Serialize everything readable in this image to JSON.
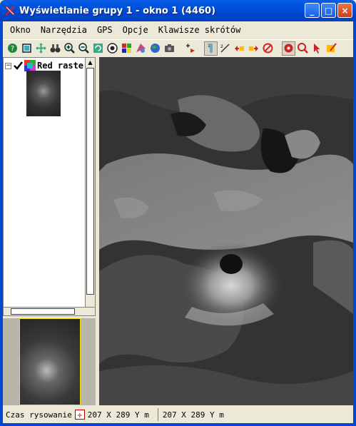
{
  "window": {
    "title": "Wyświetlanie grupy 1 - okno 1 (4460)",
    "minimize": "_",
    "maximize": "□",
    "close": "×"
  },
  "menu": [
    "Okno",
    "Narzędzia",
    "GPS",
    "Opcje",
    "Klawisze skrótów"
  ],
  "toolbar": {
    "icons": [
      "query-icon",
      "zoom-window-icon",
      "pan-icon",
      "binoculars-icon",
      "zoom-in-icon",
      "zoom-out-icon",
      "refresh-icon",
      "globe-icon",
      "layers-icon",
      "palette-icon",
      "earth-icon",
      "camera-icon",
      "add-layer-icon",
      "scale-icon",
      "measure-icon",
      "bring-up-icon",
      "bring-down-icon",
      "stop-icon",
      "record-icon",
      "magnify-icon",
      "arrow-icon",
      "edit-icon"
    ]
  },
  "layers": {
    "expander": "−",
    "name": "Red raste"
  },
  "status": {
    "drawing_time_label": "Czas rysowanie",
    "coords_left": "207 X  289 Y m",
    "coords_right": "207 X  289 Y m"
  }
}
